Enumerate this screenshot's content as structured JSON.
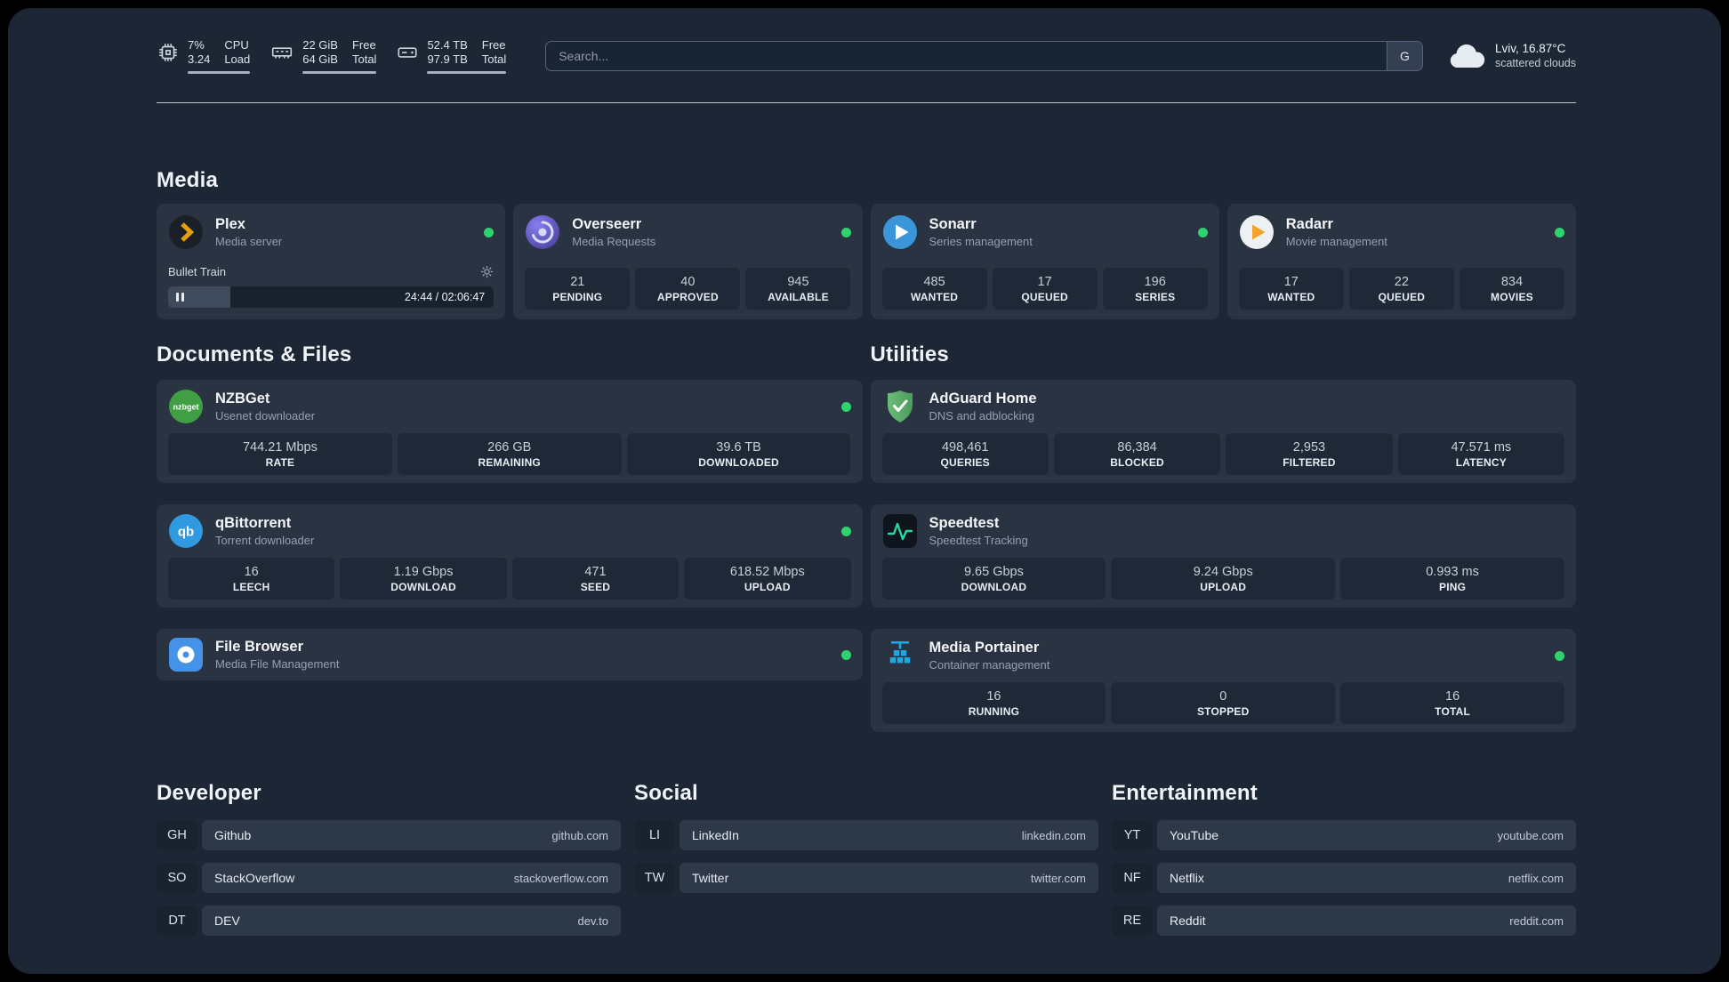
{
  "topbar": {
    "cpu": {
      "values": [
        "7%",
        "3.24"
      ],
      "labels": [
        "CPU",
        "Load"
      ]
    },
    "memory": {
      "values": [
        "22 GiB",
        "64 GiB"
      ],
      "labels": [
        "Free",
        "Total"
      ]
    },
    "disk": {
      "values": [
        "52.4 TB",
        "97.9 TB"
      ],
      "labels": [
        "Free",
        "Total"
      ]
    },
    "search": {
      "placeholder": "Search...",
      "button": "G"
    },
    "weather": {
      "line1": "Lviv, 16.87°C",
      "line2": "scattered clouds"
    }
  },
  "colors": {
    "status_online": "#2fd36e"
  },
  "sections": {
    "media": {
      "heading": "Media",
      "cards": [
        {
          "title": "Plex",
          "subtitle": "Media server",
          "status": "online",
          "player": {
            "track": "Bullet Train",
            "time": "24:44 / 02:06:47"
          }
        },
        {
          "title": "Overseerr",
          "subtitle": "Media Requests",
          "status": "online",
          "stats": [
            {
              "value": "21",
              "label": "PENDING"
            },
            {
              "value": "40",
              "label": "APPROVED"
            },
            {
              "value": "945",
              "label": "AVAILABLE"
            }
          ]
        },
        {
          "title": "Sonarr",
          "subtitle": "Series management",
          "status": "online",
          "stats": [
            {
              "value": "485",
              "label": "WANTED"
            },
            {
              "value": "17",
              "label": "QUEUED"
            },
            {
              "value": "196",
              "label": "SERIES"
            }
          ]
        },
        {
          "title": "Radarr",
          "subtitle": "Movie management",
          "status": "online",
          "stats": [
            {
              "value": "17",
              "label": "WANTED"
            },
            {
              "value": "22",
              "label": "QUEUED"
            },
            {
              "value": "834",
              "label": "MOVIES"
            }
          ]
        }
      ]
    },
    "documents": {
      "heading": "Documents & Files",
      "cards": [
        {
          "title": "NZBGet",
          "subtitle": "Usenet downloader",
          "status": "online",
          "stats": [
            {
              "value": "744.21 Mbps",
              "label": "RATE"
            },
            {
              "value": "266 GB",
              "label": "REMAINING"
            },
            {
              "value": "39.6 TB",
              "label": "DOWNLOADED"
            }
          ]
        },
        {
          "title": "qBittorrent",
          "subtitle": "Torrent downloader",
          "status": "online",
          "stats": [
            {
              "value": "16",
              "label": "LEECH"
            },
            {
              "value": "1.19 Gbps",
              "label": "DOWNLOAD"
            },
            {
              "value": "471",
              "label": "SEED"
            },
            {
              "value": "618.52 Mbps",
              "label": "UPLOAD"
            }
          ]
        },
        {
          "title": "File Browser",
          "subtitle": "Media File Management",
          "status": "online"
        }
      ]
    },
    "utilities": {
      "heading": "Utilities",
      "cards": [
        {
          "title": "AdGuard Home",
          "subtitle": "DNS and adblocking",
          "stats": [
            {
              "value": "498,461",
              "label": "QUERIES"
            },
            {
              "value": "86,384",
              "label": "BLOCKED"
            },
            {
              "value": "2,953",
              "label": "FILTERED"
            },
            {
              "value": "47.571 ms",
              "label": "LATENCY"
            }
          ]
        },
        {
          "title": "Speedtest",
          "subtitle": "Speedtest Tracking",
          "stats": [
            {
              "value": "9.65 Gbps",
              "label": "DOWNLOAD"
            },
            {
              "value": "9.24 Gbps",
              "label": "UPLOAD"
            },
            {
              "value": "0.993 ms",
              "label": "PING"
            }
          ]
        },
        {
          "title": "Media Portainer",
          "subtitle": "Container management",
          "status": "online",
          "stats": [
            {
              "value": "16",
              "label": "RUNNING"
            },
            {
              "value": "0",
              "label": "STOPPED"
            },
            {
              "value": "16",
              "label": "TOTAL"
            }
          ]
        }
      ]
    },
    "bookmarks": [
      {
        "heading": "Developer",
        "links": [
          {
            "abbr": "GH",
            "name": "Github",
            "domain": "github.com"
          },
          {
            "abbr": "SO",
            "name": "StackOverflow",
            "domain": "stackoverflow.com"
          },
          {
            "abbr": "DT",
            "name": "DEV",
            "domain": "dev.to"
          }
        ]
      },
      {
        "heading": "Social",
        "links": [
          {
            "abbr": "LI",
            "name": "LinkedIn",
            "domain": "linkedin.com"
          },
          {
            "abbr": "TW",
            "name": "Twitter",
            "domain": "twitter.com"
          }
        ]
      },
      {
        "heading": "Entertainment",
        "links": [
          {
            "abbr": "YT",
            "name": "YouTube",
            "domain": "youtube.com"
          },
          {
            "abbr": "NF",
            "name": "Netflix",
            "domain": "netflix.com"
          },
          {
            "abbr": "RE",
            "name": "Reddit",
            "domain": "reddit.com"
          }
        ]
      }
    ]
  }
}
